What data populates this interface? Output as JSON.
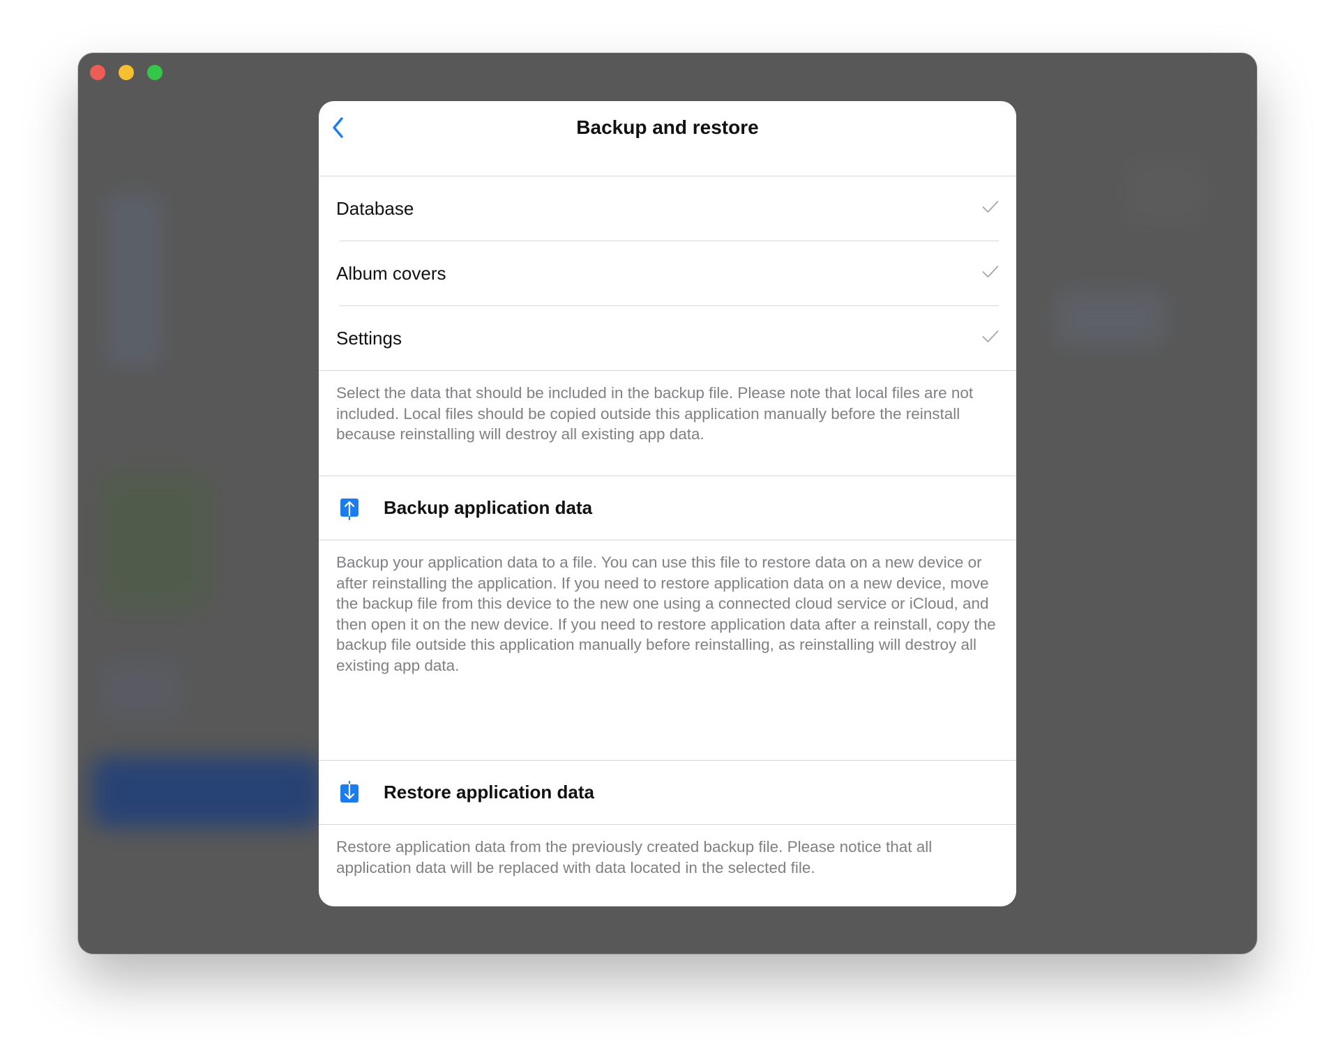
{
  "window": {
    "buttons": [
      "close",
      "minimize",
      "maximize"
    ]
  },
  "sheet": {
    "title": "Backup and restore",
    "back_icon": "chevron-left-icon",
    "items": [
      {
        "label": "Database",
        "checked": true
      },
      {
        "label": "Album covers",
        "checked": true
      },
      {
        "label": "Settings",
        "checked": true
      }
    ],
    "selection_note": "Select the data that should be included in the backup file. Please note that local files are not included. Local files should be copied outside this application manually before the reinstall because reinstalling will destroy all existing app data.",
    "backup": {
      "label": "Backup application data",
      "icon": "upload-icon",
      "description": "Backup your application data to a file. You can use this file to restore data on a new device or after reinstalling the application. If you need to restore application data on a new device, move the backup file from this device to the new one using a connected cloud service or iCloud, and then open it on the new device. If you need to restore application data after a reinstall, copy the backup file outside this application manually before reinstalling, as reinstalling will destroy all existing app data."
    },
    "restore": {
      "label": "Restore application data",
      "icon": "download-icon",
      "description": "Restore application data from the previously created backup file. Please notice that all application data will be replaced with data located in the selected file."
    }
  },
  "colors": {
    "accent": "#1a7cf0",
    "window_bg": "#585858",
    "secondary_text": "#808084",
    "check": "#a6a6aa"
  }
}
